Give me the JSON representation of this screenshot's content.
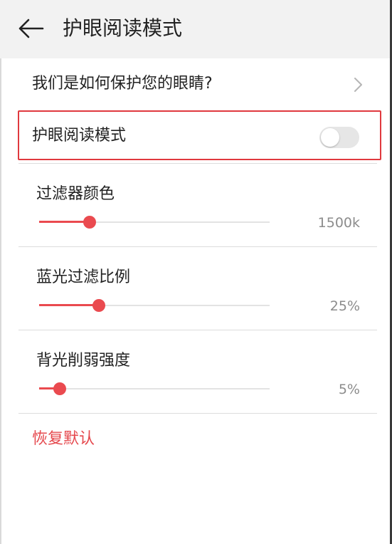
{
  "header": {
    "title": "护眼阅读模式",
    "back_icon": "arrow-left-icon"
  },
  "protect_link": {
    "label": "我们是如何保护您的眼睛?",
    "icon": "chevron-right-icon"
  },
  "eye_mode": {
    "label": "护眼阅读模式",
    "enabled": false
  },
  "filter_color": {
    "label": "过滤器颜色",
    "value_text": "1500k",
    "level": 0.22
  },
  "blue_light": {
    "label": "蓝光过滤比例",
    "value_text": "25%",
    "level": 0.26
  },
  "backlight": {
    "label": "背光削弱强度",
    "value_text": "5%",
    "level": 0.09
  },
  "reset": {
    "label": "恢复默认"
  },
  "colors": {
    "accent": "#EA4A4F",
    "highlight_border": "#E0393E",
    "header_bg": "#F2F2F2"
  }
}
